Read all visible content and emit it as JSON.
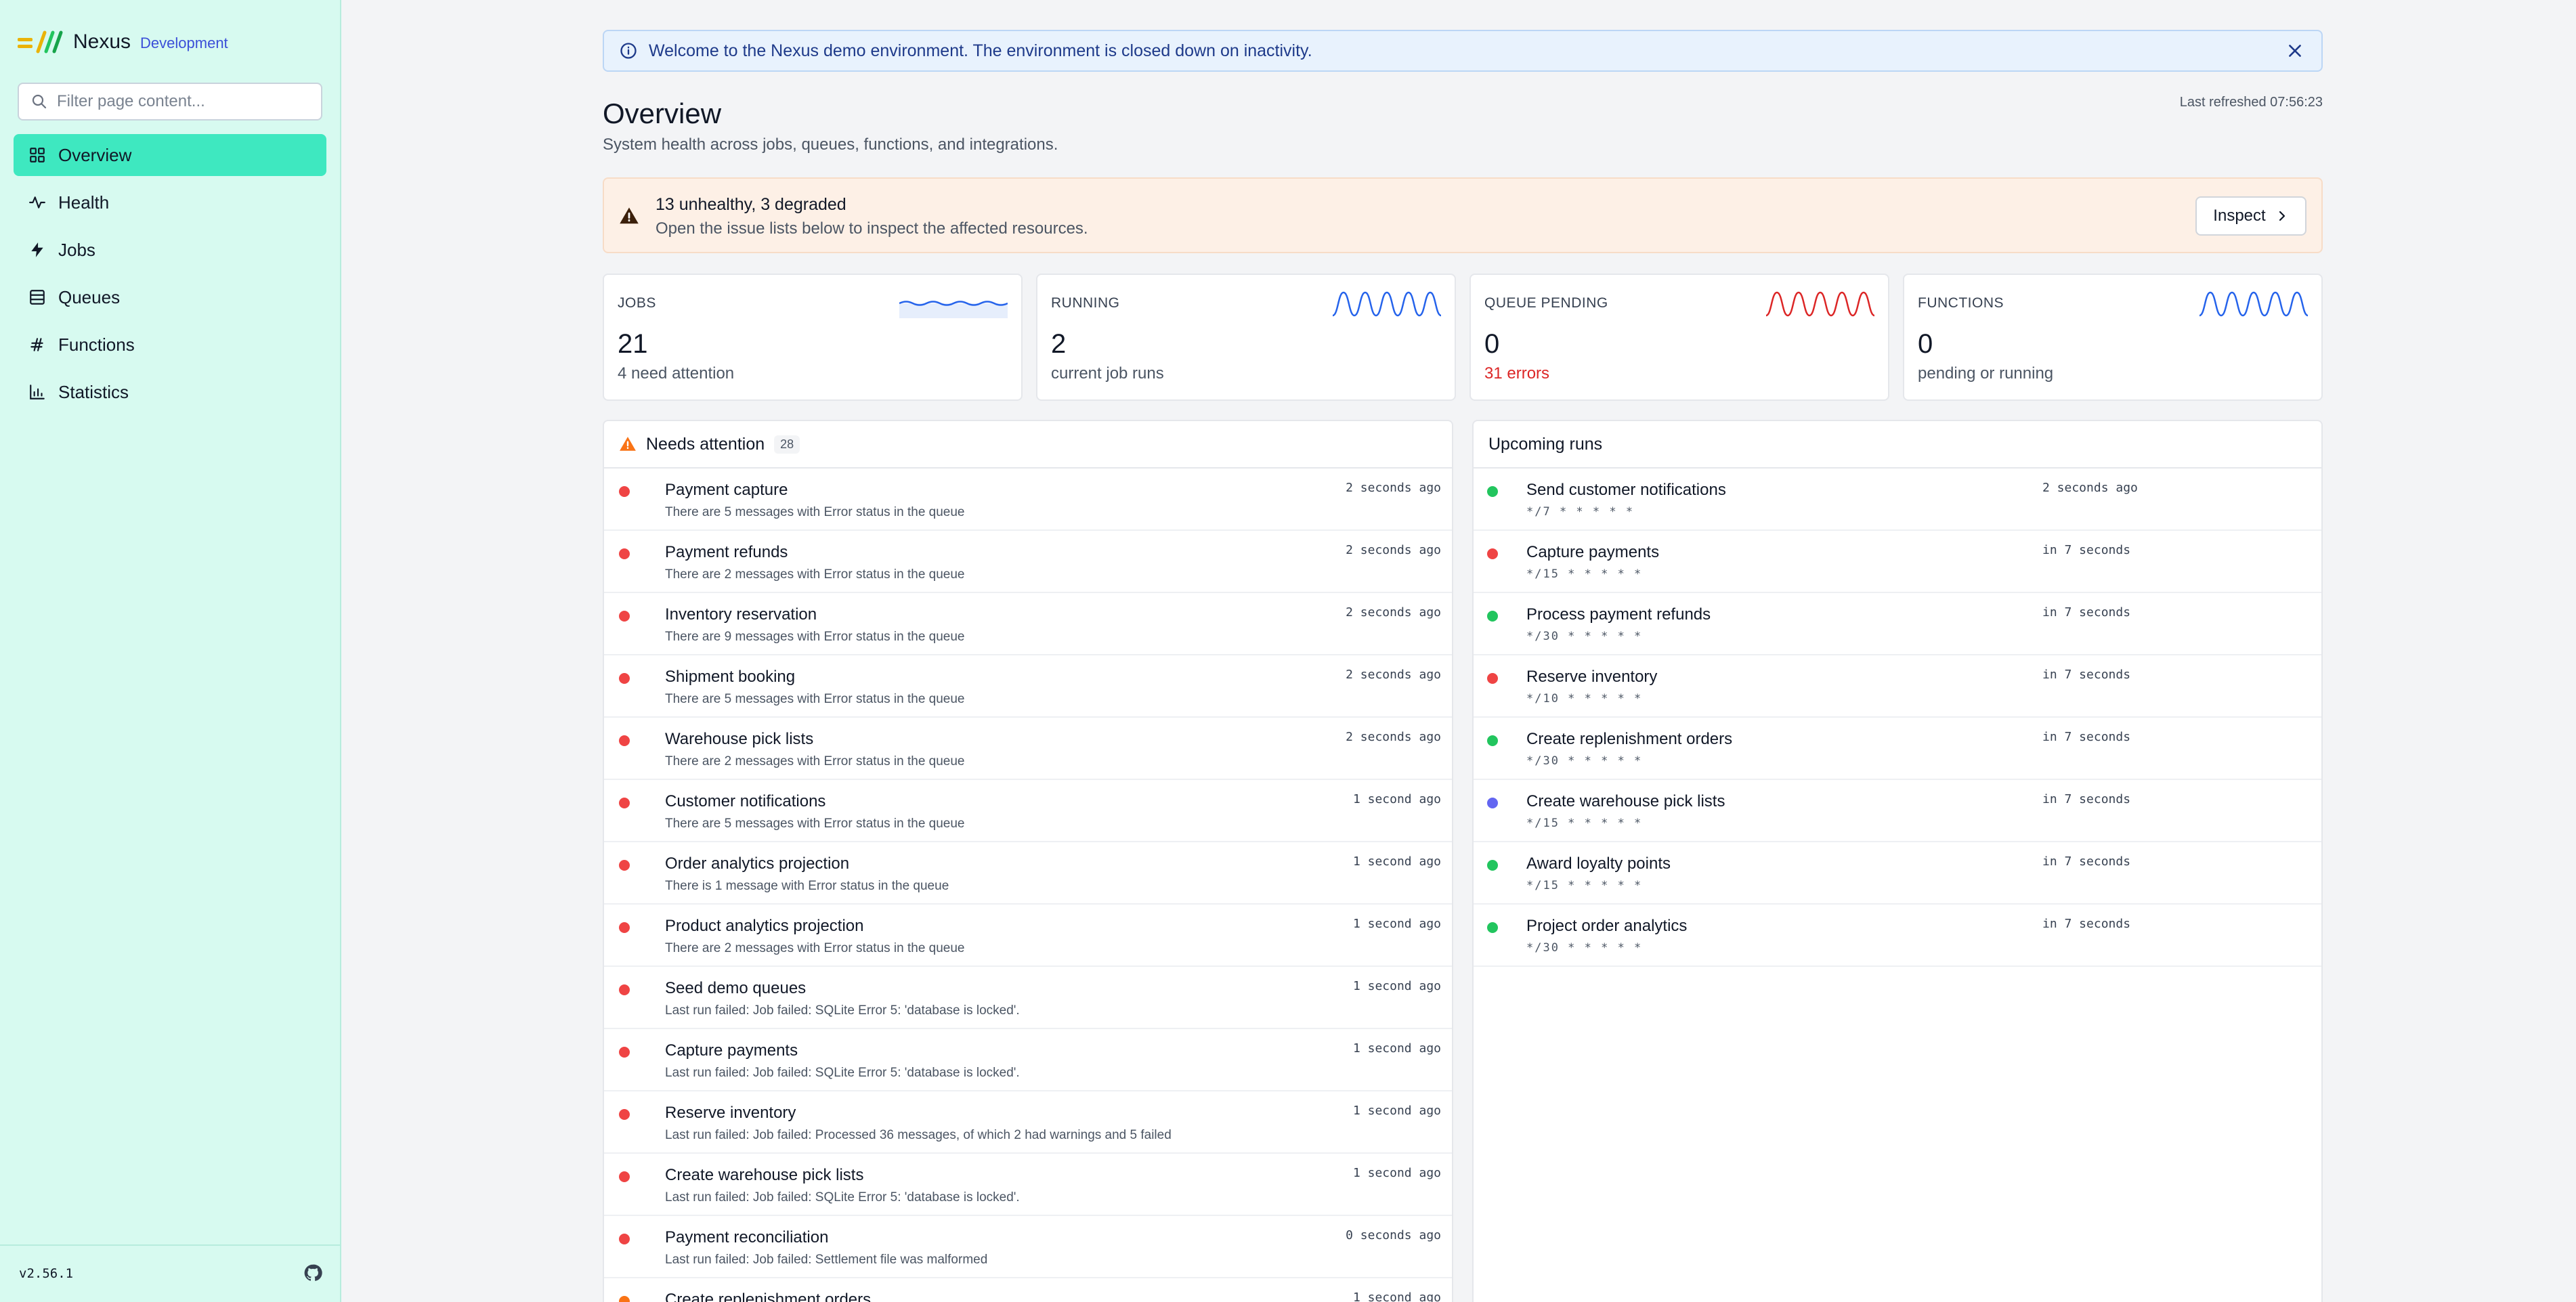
{
  "app": {
    "name": "Nexus",
    "environment": "Development",
    "version": "v2.56.1"
  },
  "search": {
    "placeholder": "Filter page content..."
  },
  "nav": [
    {
      "label": "Overview",
      "icon": "grid-icon",
      "active": true
    },
    {
      "label": "Health",
      "icon": "pulse-icon"
    },
    {
      "label": "Jobs",
      "icon": "bolt-icon"
    },
    {
      "label": "Queues",
      "icon": "stack-icon"
    },
    {
      "label": "Functions",
      "icon": "function-icon"
    },
    {
      "label": "Statistics",
      "icon": "bar-chart-icon"
    }
  ],
  "banner": {
    "text": "Welcome to the Nexus demo environment. The environment is closed down on inactivity."
  },
  "page": {
    "title": "Overview",
    "subtitle": "System health across jobs, queues, functions, and integrations.",
    "last_refreshed": "Last refreshed 07:56:23"
  },
  "alert": {
    "title": "13 unhealthy, 3 degraded",
    "subtitle": "Open the issue lists below to inspect the affected resources.",
    "button": "Inspect"
  },
  "stats": [
    {
      "label": "JOBS",
      "value": "21",
      "sub": "4 need attention",
      "spark_color": "#2563eb"
    },
    {
      "label": "RUNNING",
      "value": "2",
      "sub": "current job runs",
      "spark_color": "#2563eb"
    },
    {
      "label": "QUEUE PENDING",
      "value": "0",
      "sub": "31 errors",
      "spark_color": "#dc2626"
    },
    {
      "label": "FUNCTIONS",
      "value": "0",
      "sub": "pending or running",
      "spark_color": "#2563eb"
    }
  ],
  "attention": {
    "title": "Needs attention",
    "count": "28",
    "items": [
      {
        "title": "Payment capture",
        "detail": "There are 5 messages with Error status in the queue",
        "time": "2 seconds ago",
        "status": "#ef4444"
      },
      {
        "title": "Payment refunds",
        "detail": "There are 2 messages with Error status in the queue",
        "time": "2 seconds ago",
        "status": "#ef4444"
      },
      {
        "title": "Inventory reservation",
        "detail": "There are 9 messages with Error status in the queue",
        "time": "2 seconds ago",
        "status": "#ef4444"
      },
      {
        "title": "Shipment booking",
        "detail": "There are 5 messages with Error status in the queue",
        "time": "2 seconds ago",
        "status": "#ef4444"
      },
      {
        "title": "Warehouse pick lists",
        "detail": "There are 2 messages with Error status in the queue",
        "time": "2 seconds ago",
        "status": "#ef4444"
      },
      {
        "title": "Customer notifications",
        "detail": "There are 5 messages with Error status in the queue",
        "time": "1 second ago",
        "status": "#ef4444"
      },
      {
        "title": "Order analytics projection",
        "detail": "There is 1 message with Error status in the queue",
        "time": "1 second ago",
        "status": "#ef4444"
      },
      {
        "title": "Product analytics projection",
        "detail": "There are 2 messages with Error status in the queue",
        "time": "1 second ago",
        "status": "#ef4444"
      },
      {
        "title": "Seed demo queues",
        "detail": "Last run failed: Job failed: SQLite Error 5: 'database is locked'.",
        "time": "1 second ago",
        "status": "#ef4444"
      },
      {
        "title": "Capture payments",
        "detail": "Last run failed: Job failed: SQLite Error 5: 'database is locked'.",
        "time": "1 second ago",
        "status": "#ef4444"
      },
      {
        "title": "Reserve inventory",
        "detail": "Last run failed: Job failed: Processed 36 messages, of which 2 had warnings and 5 failed",
        "time": "1 second ago",
        "status": "#ef4444"
      },
      {
        "title": "Create warehouse pick lists",
        "detail": "Last run failed: Job failed: SQLite Error 5: 'database is locked'.",
        "time": "1 second ago",
        "status": "#ef4444"
      },
      {
        "title": "Payment reconciliation",
        "detail": "Last run failed: Job failed: Settlement file was malformed",
        "time": "0 seconds ago",
        "status": "#ef4444"
      },
      {
        "title": "Create replenishment orders",
        "detail": "",
        "time": "1 second ago",
        "status": "#f97316"
      }
    ]
  },
  "upcoming": {
    "title": "Upcoming runs",
    "items": [
      {
        "title": "Send customer notifications",
        "cron": "*/7 * * * * *",
        "time": "2 seconds ago",
        "status": "#22c55e"
      },
      {
        "title": "Capture payments",
        "cron": "*/15 * * * * *",
        "time": "in 7 seconds",
        "status": "#ef4444"
      },
      {
        "title": "Process payment refunds",
        "cron": "*/30 * * * * *",
        "time": "in 7 seconds",
        "status": "#22c55e"
      },
      {
        "title": "Reserve inventory",
        "cron": "*/10 * * * * *",
        "time": "in 7 seconds",
        "status": "#ef4444"
      },
      {
        "title": "Create replenishment orders",
        "cron": "*/30 * * * * *",
        "time": "in 7 seconds",
        "status": "#22c55e"
      },
      {
        "title": "Create warehouse pick lists",
        "cron": "*/15 * * * * *",
        "time": "in 7 seconds",
        "status": "#6366f1"
      },
      {
        "title": "Award loyalty points",
        "cron": "*/15 * * * * *",
        "time": "in 7 seconds",
        "status": "#22c55e"
      },
      {
        "title": "Project order analytics",
        "cron": "*/30 * * * * *",
        "time": "in 7 seconds",
        "status": "#22c55e"
      }
    ]
  }
}
